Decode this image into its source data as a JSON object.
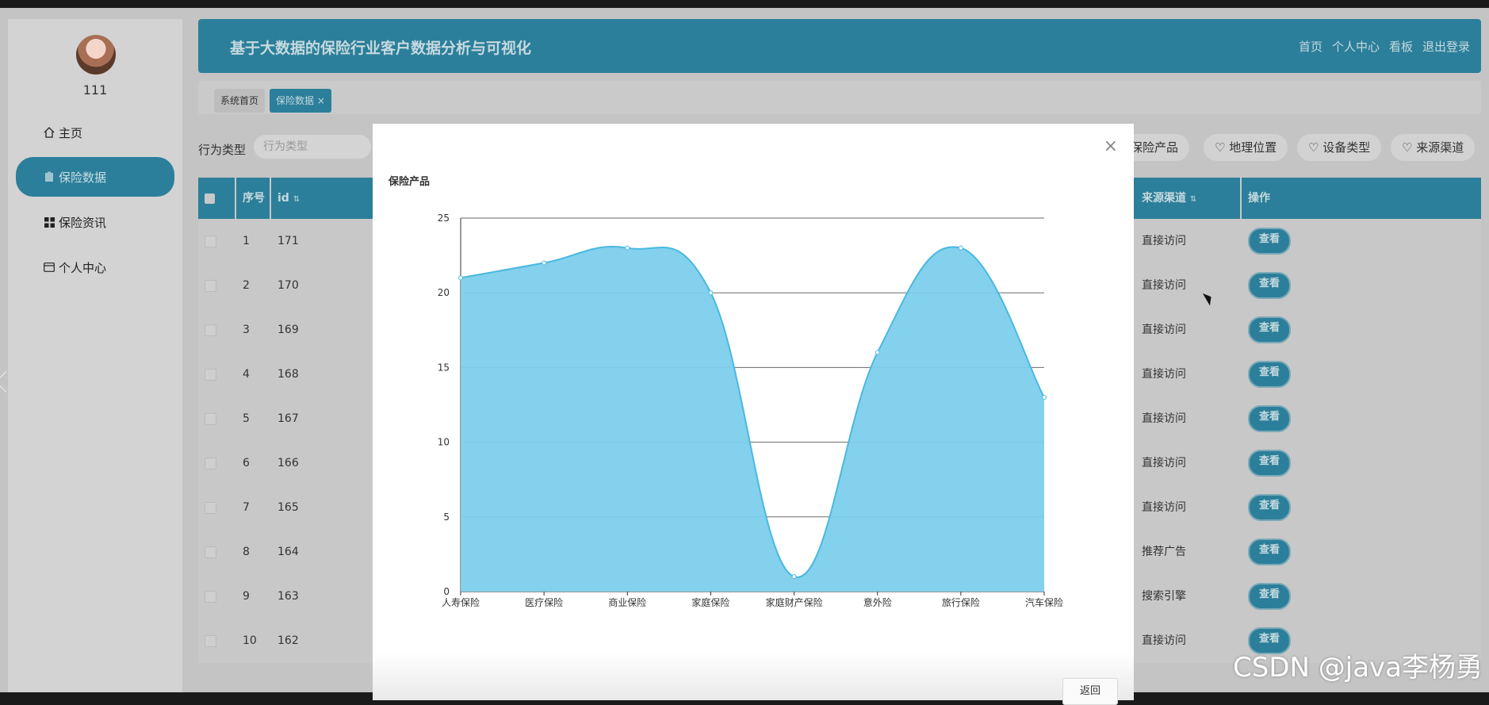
{
  "sidebar": {
    "username": "111",
    "items": [
      {
        "label": "主页",
        "icon": "home-icon"
      },
      {
        "label": "保险数据",
        "icon": "clipboard-icon",
        "active": true
      },
      {
        "label": "保险资讯",
        "icon": "grid-icon"
      },
      {
        "label": "个人中心",
        "icon": "wallet-icon"
      }
    ]
  },
  "header": {
    "title": "基于大数据的保险行业客户数据分析与可视化",
    "links": [
      "首页",
      "个人中心",
      "看板",
      "退出登录"
    ]
  },
  "tabs": [
    {
      "label": "系统首页"
    },
    {
      "label": "保险数据"
    }
  ],
  "filters": {
    "label": "行为类型",
    "placeholder": "行为类型",
    "chips": [
      "保险产品",
      "地理位置",
      "设备类型",
      "来源渠道"
    ]
  },
  "table": {
    "headers": {
      "index": "序号",
      "id": "id",
      "source": "来源渠道",
      "action": "操作"
    },
    "rows": [
      {
        "index": "1",
        "id": "171",
        "source": "直接访问",
        "action": "查看"
      },
      {
        "index": "2",
        "id": "170",
        "source": "直接访问",
        "action": "查看"
      },
      {
        "index": "3",
        "id": "169",
        "source": "直接访问",
        "action": "查看"
      },
      {
        "index": "4",
        "id": "168",
        "source": "直接访问",
        "action": "查看"
      },
      {
        "index": "5",
        "id": "167",
        "source": "直接访问",
        "action": "查看"
      },
      {
        "index": "6",
        "id": "166",
        "source": "直接访问",
        "action": "查看"
      },
      {
        "index": "7",
        "id": "165",
        "source": "直接访问",
        "action": "查看"
      },
      {
        "index": "8",
        "id": "164",
        "source": "推荐广告",
        "action": "查看"
      },
      {
        "index": "9",
        "id": "163",
        "source": "搜索引擎",
        "action": "查看"
      },
      {
        "index": "10",
        "id": "162",
        "source": "直接访问",
        "action": "查看"
      }
    ]
  },
  "modal": {
    "title": "保险产品",
    "back_label": "返回"
  },
  "chart_data": {
    "type": "area",
    "title": "保险产品",
    "categories": [
      "人寿保险",
      "医疗保险",
      "商业保险",
      "家庭保险",
      "家庭财产保险",
      "意外险",
      "旅行保险",
      "汽车保险"
    ],
    "values": [
      21,
      22,
      23,
      20,
      1,
      16,
      23,
      13
    ],
    "ylim": [
      0,
      25
    ],
    "yticks": [
      0,
      5,
      10,
      15,
      20,
      25
    ],
    "grid": true,
    "smooth": true,
    "color": "#7ccfec",
    "line_color": "#4ab8e0"
  },
  "watermark": "CSDN @java李杨勇",
  "colors": {
    "primary": "#2c7f9a",
    "overlay": "#c4c4c4"
  }
}
